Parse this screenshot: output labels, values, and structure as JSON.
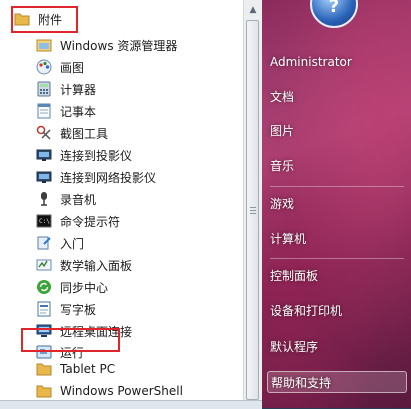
{
  "programs": {
    "folder_label": "附件",
    "items": [
      "Windows 资源管理器",
      "画图",
      "计算器",
      "记事本",
      "截图工具",
      "连接到投影仪",
      "连接到网络投影仪",
      "录音机",
      "命令提示符",
      "入门",
      "数学输入面板",
      "同步中心",
      "写字板",
      "远程桌面连接",
      "运行"
    ],
    "sub_folders": [
      "Tablet PC",
      "Windows PowerShell"
    ]
  },
  "right_pane": {
    "user": "Administrator",
    "items": [
      "文档",
      "图片",
      "音乐",
      "游戏",
      "计算机",
      "控制面板",
      "设备和打印机",
      "默认程序",
      "帮助和支持"
    ]
  },
  "colors": {
    "highlight_border": "#e0262b",
    "folder_yellow": "#e8b84a",
    "right_pane": "#9a3468"
  },
  "icons": {
    "folder": "folder-icon",
    "explorer": "explorer-icon",
    "paint": "paint-icon",
    "calculator": "calculator-icon",
    "notepad": "notepad-icon",
    "snipping": "scissors-icon",
    "projector": "projector-icon",
    "recorder": "microphone-icon",
    "cmd": "command-prompt-icon",
    "getting_started": "getting-started-icon",
    "math_input": "math-input-icon",
    "sync": "sync-icon",
    "wordpad": "wordpad-icon",
    "remote": "remote-desktop-icon",
    "run": "run-icon"
  }
}
